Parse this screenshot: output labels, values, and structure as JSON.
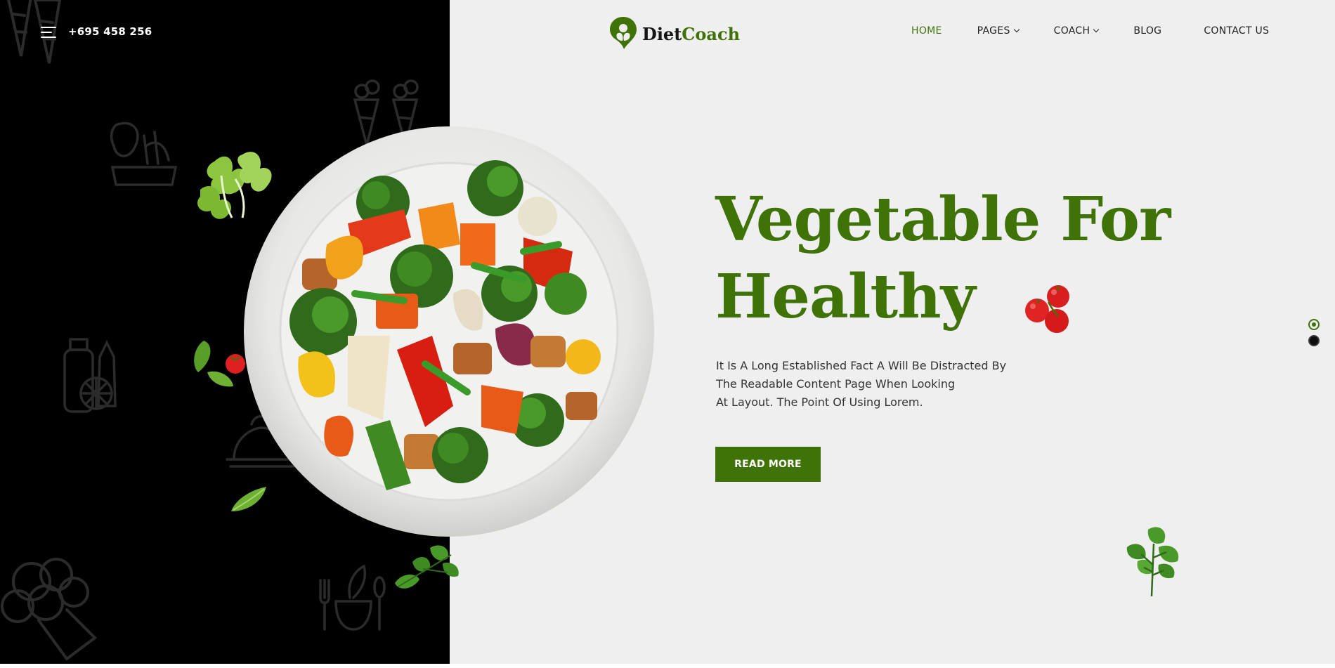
{
  "header": {
    "phone": "+695 458 256",
    "logo": {
      "part1": "Diet",
      "part2": "Coach"
    }
  },
  "nav": {
    "items": [
      {
        "label": "HOME",
        "active": true,
        "has_dropdown": false
      },
      {
        "label": "PAGES",
        "active": false,
        "has_dropdown": true
      },
      {
        "label": "COACH",
        "active": false,
        "has_dropdown": true
      },
      {
        "label": "BLOG",
        "active": false,
        "has_dropdown": false
      },
      {
        "label": "CONTACT US",
        "active": false,
        "has_dropdown": false
      }
    ]
  },
  "hero": {
    "title_line1": "Vegetable For",
    "title_line2": "Healthy",
    "description": [
      "It Is A Long Established Fact A Will Be Distracted By",
      "The Readable Content Page When Looking",
      "At Layout. The Point Of Using Lorem."
    ],
    "cta_label": "READ MORE"
  },
  "slider": {
    "slide_count": 2,
    "active_index": 0
  },
  "colors": {
    "brand_green": "#3f7308",
    "left_panel": "#000000",
    "background": "#efefef",
    "text_dark": "#1e1e1e"
  },
  "icons": [
    "hamburger-menu-icon",
    "logo-leaf-icon",
    "chevron-down-icon",
    "vegetable-bowl-image",
    "tomato-icon",
    "parsley-icon",
    "lettuce-icon",
    "basil-leaf-icon",
    "carrot-doodle-icon",
    "broccoli-doodle-icon",
    "bottles-doodle-icon",
    "salad-bowl-doodle-icon"
  ]
}
